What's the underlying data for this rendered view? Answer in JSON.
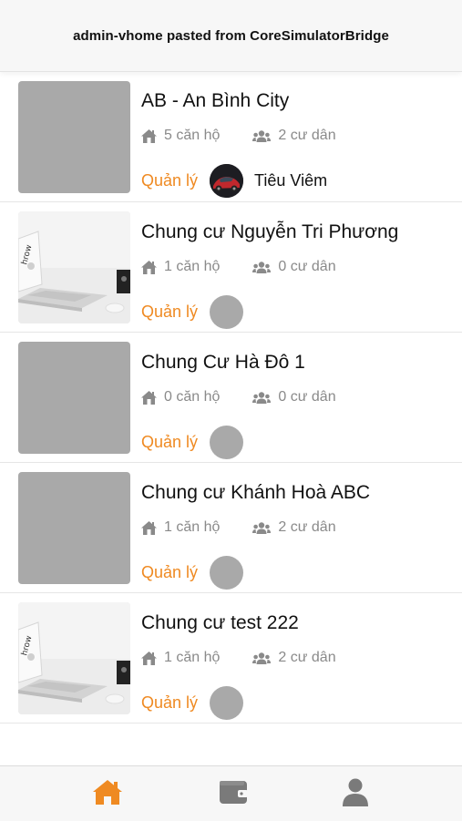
{
  "toast": {
    "text": "admin-vhome pasted from CoreSimulatorBridge"
  },
  "colors": {
    "accent": "#ef8a22",
    "placeholder": "#a9a9a9",
    "muted": "#8a8a8a"
  },
  "buildings": [
    {
      "name": "AB - An Bình City",
      "apartments": "5 căn hộ",
      "residents": "2 cư dân",
      "manage_label": "Quản lý",
      "manager_name": "Tiêu Viêm",
      "thumb": "placeholder",
      "avatar": "photo"
    },
    {
      "name": "Chung cư Nguyễn Tri Phương",
      "apartments": "1 căn hộ",
      "residents": "0 cư dân",
      "manage_label": "Quản lý",
      "manager_name": "",
      "thumb": "photo",
      "avatar": "placeholder"
    },
    {
      "name": "Chung Cư Hà Đô 1",
      "apartments": "0 căn hộ",
      "residents": "0 cư dân",
      "manage_label": "Quản lý",
      "manager_name": "",
      "thumb": "placeholder",
      "avatar": "placeholder"
    },
    {
      "name": "Chung cư Khánh Hoà ABC",
      "apartments": "1 căn hộ",
      "residents": "2 cư dân",
      "manage_label": "Quản lý",
      "manager_name": "",
      "thumb": "placeholder",
      "avatar": "placeholder"
    },
    {
      "name": "Chung cư test 222",
      "apartments": "1 căn hộ",
      "residents": "2 cư dân",
      "manage_label": "Quản lý",
      "manager_name": "",
      "thumb": "photo",
      "avatar": "placeholder"
    }
  ],
  "tabbar": {
    "tabs": [
      {
        "icon": "home-icon",
        "active": true,
        "color": "#ef8a22"
      },
      {
        "icon": "wallet-icon",
        "active": false,
        "color": "#7a7a7a"
      },
      {
        "icon": "user-icon",
        "active": false,
        "color": "#7a7a7a"
      }
    ]
  }
}
